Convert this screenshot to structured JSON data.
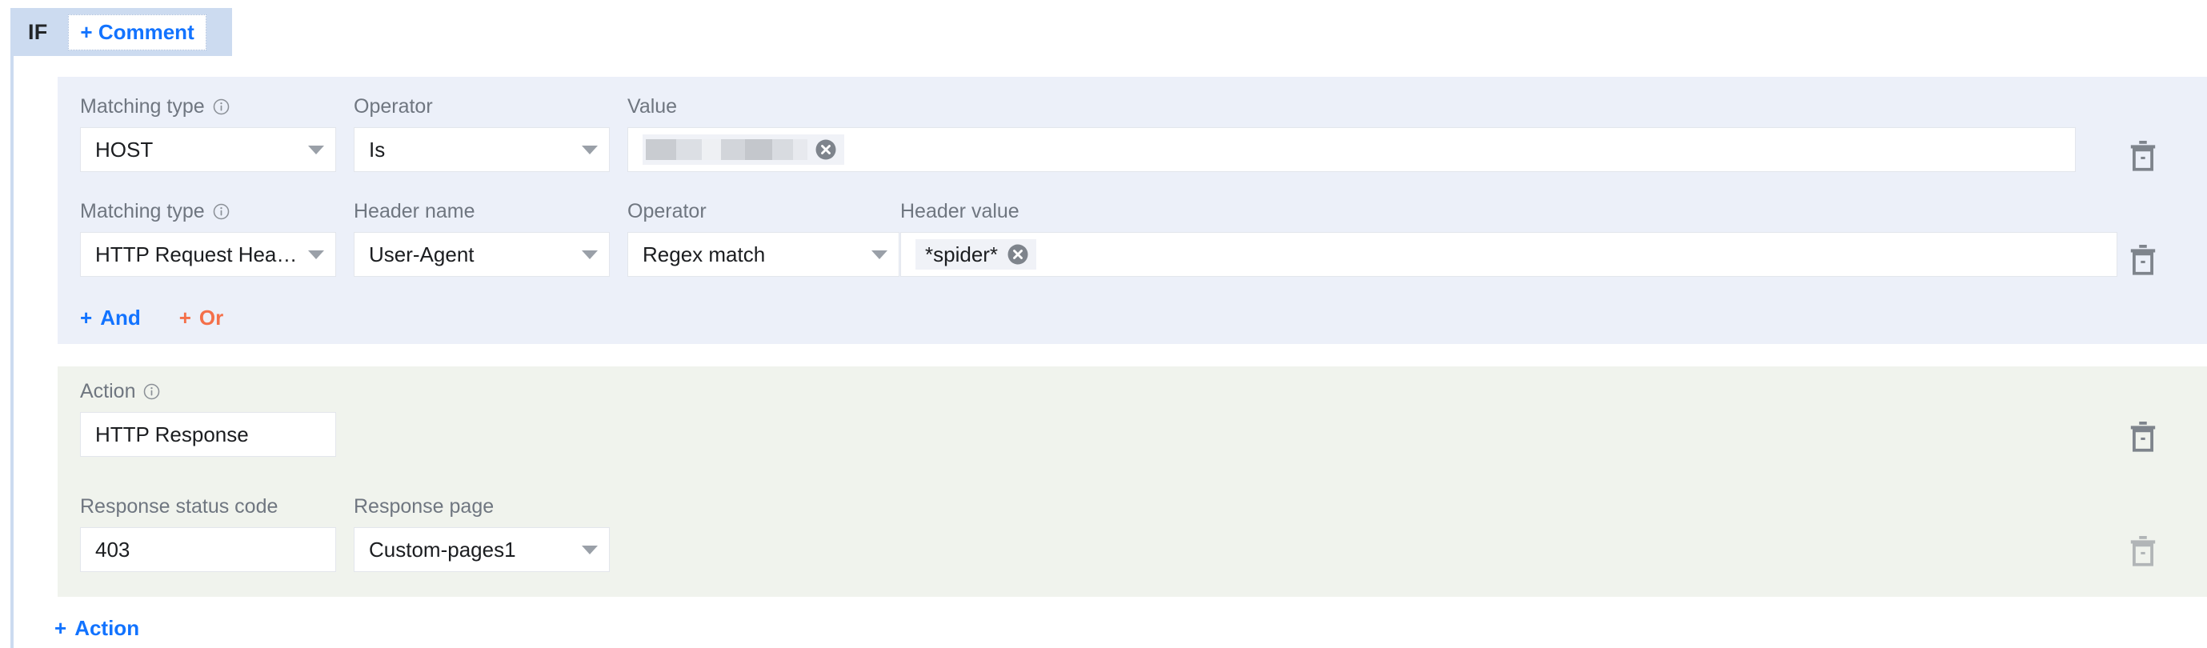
{
  "header": {
    "if_label": "IF",
    "comment_button": "+ Comment",
    "comment_plus": "+",
    "comment_text": "Comment"
  },
  "condition_panel": {
    "rows": [
      {
        "fields": [
          {
            "label": "Matching type",
            "has_info": true,
            "type": "select",
            "value": "HOST"
          },
          {
            "label": "Operator",
            "has_info": false,
            "type": "select",
            "value": "Is"
          },
          {
            "label": "Value",
            "has_info": false,
            "type": "tokens",
            "value": "",
            "redacted": true
          }
        ]
      },
      {
        "fields": [
          {
            "label": "Matching type",
            "has_info": true,
            "type": "select",
            "value": "HTTP Request Header"
          },
          {
            "label": "Header name",
            "has_info": false,
            "type": "select",
            "value": "User-Agent"
          },
          {
            "label": "Operator",
            "has_info": false,
            "type": "select",
            "value": "Regex match"
          },
          {
            "label": "Header value",
            "has_info": false,
            "type": "tokens",
            "value": "*spider*",
            "redacted": false
          }
        ]
      }
    ],
    "logic": {
      "and_plus": "+",
      "and_label": "And",
      "or_plus": "+",
      "or_label": "Or"
    }
  },
  "action_panel": {
    "action": {
      "label": "Action",
      "has_info": true,
      "value": "HTTP Response"
    },
    "status_code": {
      "label": "Response status code",
      "value": "403"
    },
    "response_page": {
      "label": "Response page",
      "value": "Custom-pages1"
    }
  },
  "footer": {
    "add_action_plus": "+",
    "add_action_label": "Action"
  },
  "icons": {
    "delete_row_1": "trash-icon",
    "delete_row_2": "trash-icon",
    "delete_action": "trash-icon",
    "delete_response": "trash-icon"
  },
  "colors": {
    "condition_bg": "#ecf0f9",
    "action_bg": "#f0f3ed",
    "header_bg": "#ccdbf0",
    "link_blue": "#1273ff",
    "link_orange": "#f4704a",
    "label_gray": "#6f7680"
  }
}
